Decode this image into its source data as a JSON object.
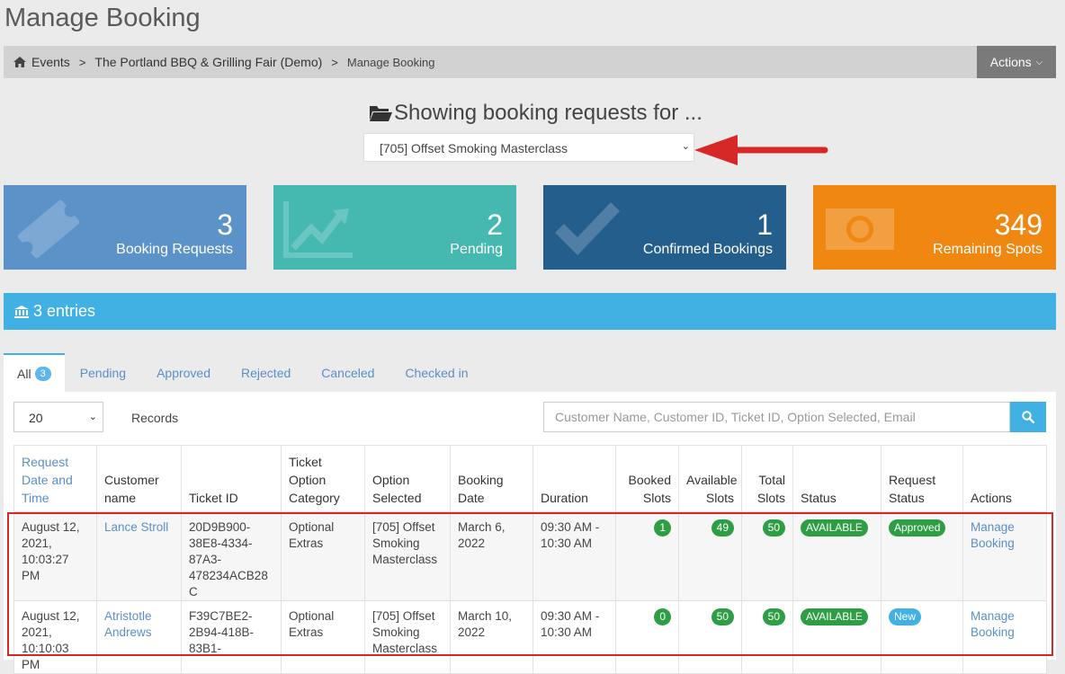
{
  "page": {
    "title": "Manage Booking"
  },
  "breadcrumb": {
    "items": [
      "Events",
      "The Portland BBQ & Grilling Fair (Demo)"
    ],
    "current": "Manage Booking",
    "separator": ">"
  },
  "header": {
    "actions_label": "Actions"
  },
  "event_selector": {
    "heading": "Showing booking requests for ...",
    "selected": "[705] Offset Smoking Masterclass"
  },
  "stats": [
    {
      "value": "3",
      "label": "Booking Requests",
      "color": "#5b93c8",
      "icon": "ticket-icon"
    },
    {
      "value": "2",
      "label": "Pending",
      "color": "#45b8b0",
      "icon": "chart-icon"
    },
    {
      "value": "1",
      "label": "Confirmed Bookings",
      "color": "#245e8d",
      "icon": "check-icon"
    },
    {
      "value": "349",
      "label": "Remaining Spots",
      "color": "#ef8711",
      "icon": "money-icon"
    }
  ],
  "entries": {
    "label": "3 entries"
  },
  "tabs": [
    {
      "label": "All",
      "badge": "3",
      "active": true
    },
    {
      "label": "Pending"
    },
    {
      "label": "Approved"
    },
    {
      "label": "Rejected"
    },
    {
      "label": "Canceled"
    },
    {
      "label": "Checked in"
    }
  ],
  "table_controls": {
    "page_length": "20",
    "records_label": "Records",
    "search_placeholder": "Customer Name, Customer ID, Ticket ID, Option Selected, Email"
  },
  "table": {
    "columns": [
      "Request Date and Time",
      "Customer name",
      "Ticket ID",
      "Ticket Option Category",
      "Option Selected",
      "Booking Date",
      "Duration",
      "Booked Slots",
      "Available Slots",
      "Total Slots",
      "Status",
      "Request Status",
      "Actions"
    ],
    "rows": [
      {
        "request_date": "August 12, 2021, 10:03:27 PM",
        "customer": "Lance Stroll",
        "ticket_id": "20D9B900-38E8-4334-87A3-478234ACB28C",
        "category": "Optional Extras",
        "option": "[705] Offset Smoking Masterclass",
        "booking_date": "March 6, 2022",
        "duration": "09:30 AM - 10:30 AM",
        "booked": "1",
        "available": "49",
        "total": "50",
        "status": "AVAILABLE",
        "request_status": "Approved",
        "action": "Manage Booking"
      },
      {
        "request_date": "August 12, 2021, 10:10:03 PM",
        "customer": "Atristotle Andrews",
        "ticket_id": "F39C7BE2-2B94-418B-83B1-",
        "category": "Optional Extras",
        "option": "[705] Offset Smoking Masterclass",
        "booking_date": "March 10, 2022",
        "duration": "09:30 AM - 10:30 AM",
        "booked": "0",
        "available": "50",
        "total": "50",
        "status": "AVAILABLE",
        "request_status": "New",
        "action": "Manage Booking"
      }
    ]
  },
  "colors": {
    "accent": "#41b1e4",
    "status_green": "#2e9e45",
    "annotation_red": "#d72828"
  }
}
